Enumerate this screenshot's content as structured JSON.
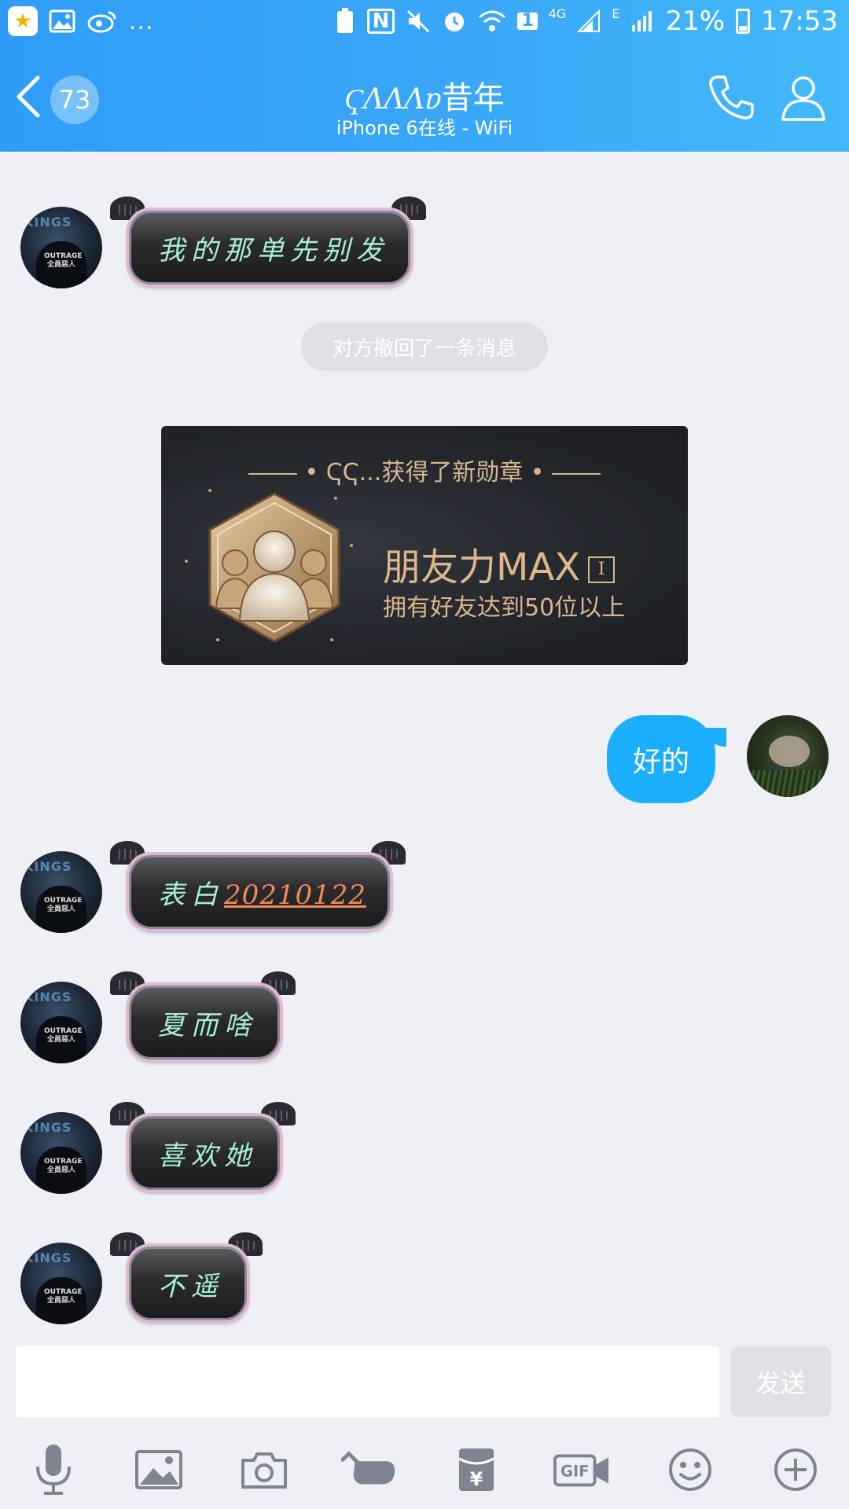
{
  "status_bar": {
    "left_dots": "...",
    "battery_percent": "21%",
    "time": "17:53",
    "network_label": "4G",
    "edge_label": "E",
    "sim_label": "1",
    "nfc_label": "N"
  },
  "header": {
    "unread_count": "73",
    "title_fancy": "ҀɅɅɅɐ",
    "title_name": "昔年",
    "subtitle": "iPhone 6在线 - WiFi"
  },
  "messages": [
    {
      "side": "other",
      "text": "我的那单先别发"
    },
    {
      "side": "system",
      "text": "对方撤回了一条消息"
    },
    {
      "side": "medal",
      "header": "ҀҀ...获得了新勋章",
      "name": "朋友力MAX",
      "level": "I",
      "desc": "拥有好友达到50位以上"
    },
    {
      "side": "me",
      "text": "好的"
    },
    {
      "side": "other",
      "prefix": "表白",
      "link": "20210122"
    },
    {
      "side": "other",
      "text": "夏而啥"
    },
    {
      "side": "other",
      "text": "喜欢她"
    },
    {
      "side": "other",
      "text": "不遥"
    }
  ],
  "avatar_text": {
    "shirt": "OUTRAGE 全員惡人",
    "glow": "KINGS"
  },
  "input": {
    "placeholder": "",
    "send_label": "发送"
  },
  "toolbar": [
    "mic-icon",
    "image-icon",
    "camera-icon",
    "poke-icon",
    "red-packet-icon",
    "gif-icon",
    "emoji-icon",
    "plus-icon"
  ],
  "toolbar_labels": {
    "gif": "GIF",
    "yen": "¥"
  },
  "colors": {
    "header_start": "#2f9df7",
    "header_end": "#43b9f9",
    "my_bubble": "#1aaefc",
    "bubble_text": "#a8f0d8",
    "link": "#ee8a58",
    "medal_gold": "#ddb78b"
  }
}
